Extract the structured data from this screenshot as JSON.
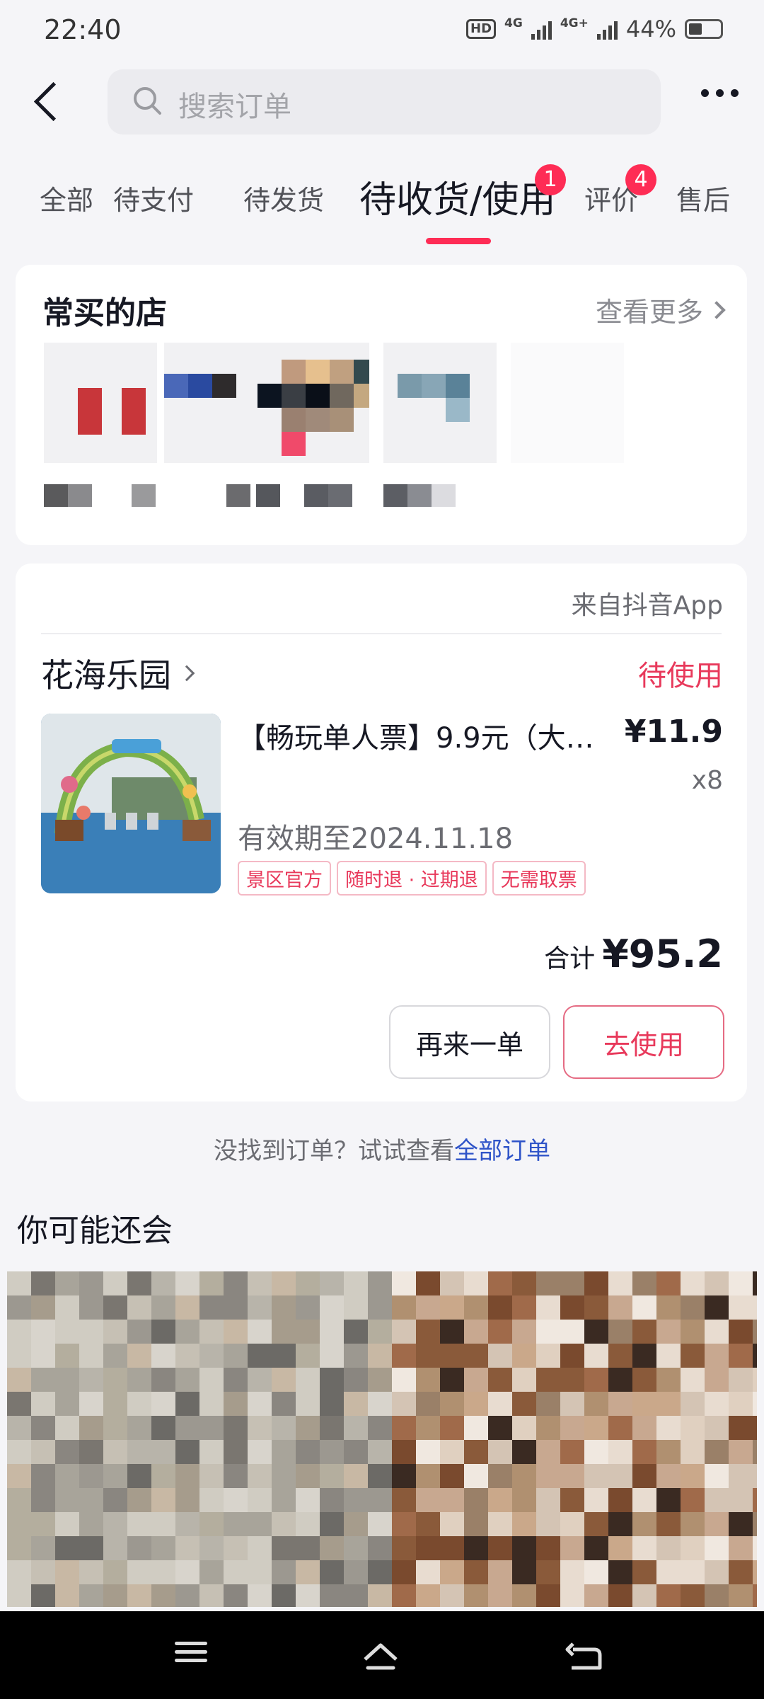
{
  "status_bar": {
    "time": "22:40",
    "hd_label": "HD",
    "network_1": "4G",
    "network_2": "4G+",
    "battery_percent": "44%",
    "battery_level": 0.44
  },
  "header": {
    "search_placeholder": "搜索订单",
    "back_icon": "chevron-left-icon",
    "more_icon": "more-horizontal-icon"
  },
  "tabs": [
    {
      "label": "全部",
      "active": false
    },
    {
      "label": "待支付",
      "active": false
    },
    {
      "label": "待发货",
      "active": false
    },
    {
      "label": "待收货/使用",
      "active": true,
      "badge": "1"
    },
    {
      "label": "评价",
      "active": false,
      "badge": "4"
    },
    {
      "label": "售后",
      "active": false
    }
  ],
  "frequent_shops": {
    "title": "常买的店",
    "see_more": "查看更多"
  },
  "order": {
    "source": "来自抖音App",
    "store_name": "花海乐园",
    "status": "待使用",
    "product_title": "【畅玩单人票】9.9元（大…",
    "price": "¥11.9",
    "quantity": "x8",
    "validity": "有效期至2024.11.18",
    "tags": [
      "景区官方",
      "随时退 · 过期退",
      "无需取票"
    ],
    "total_label": "合计",
    "total_value": "¥95.2",
    "reorder_button": "再来一单",
    "use_button": "去使用"
  },
  "hint": {
    "text": "没找到订单？试试查看",
    "link": "全部订单"
  },
  "recommend": {
    "title": "你可能还会"
  },
  "colors": {
    "accent": "#fe2c55",
    "status_red": "#e8395b",
    "link_blue": "#2f54c8"
  }
}
